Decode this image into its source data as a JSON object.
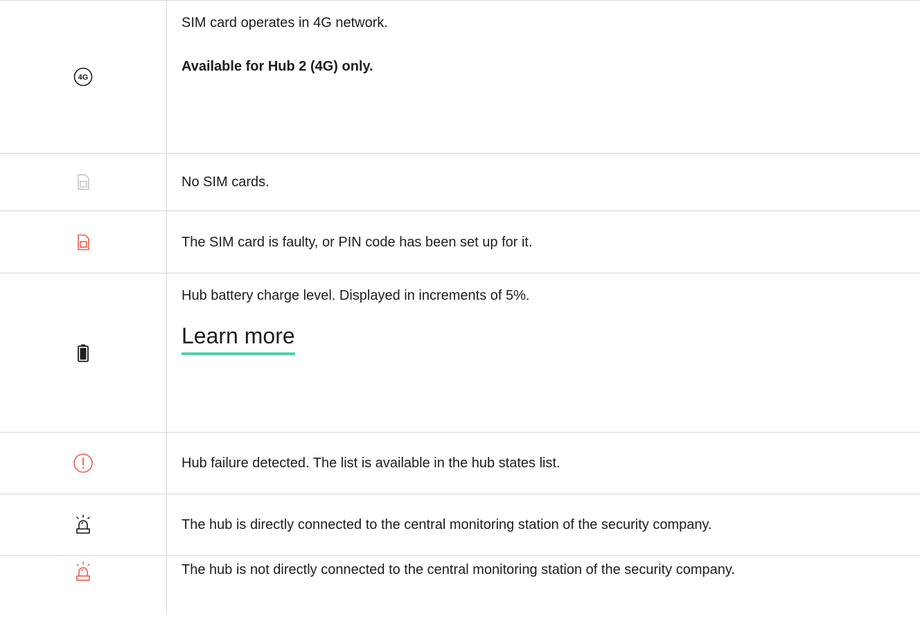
{
  "rows": [
    {
      "icon": "4g-network-icon",
      "icon_text": "4G",
      "text": "SIM card operates in 4G network.",
      "note": "Available for Hub 2 (4G) only."
    },
    {
      "icon": "no-sim-icon",
      "text": "No SIM cards."
    },
    {
      "icon": "faulty-sim-icon",
      "text": "The SIM card is faulty, or PIN code has been set up for it."
    },
    {
      "icon": "battery-icon",
      "text": "Hub battery charge level. Displayed in increments of 5%.",
      "link": "Learn more"
    },
    {
      "icon": "failure-alert-icon",
      "text": "Hub failure detected. The list is available in the hub states list."
    },
    {
      "icon": "siren-connected-icon",
      "text": "The hub is directly connected to the central monitoring station of the security company."
    },
    {
      "icon": "siren-disconnected-icon",
      "text": "The hub is not directly connected to the central monitoring station of the security company."
    }
  ],
  "colors": {
    "text": "#1d1d1f",
    "border": "#d7d7d7",
    "alert_red": "#ef5a4a",
    "inactive_gray": "#bdbdbd",
    "link_underline": "#4fd1a5"
  }
}
